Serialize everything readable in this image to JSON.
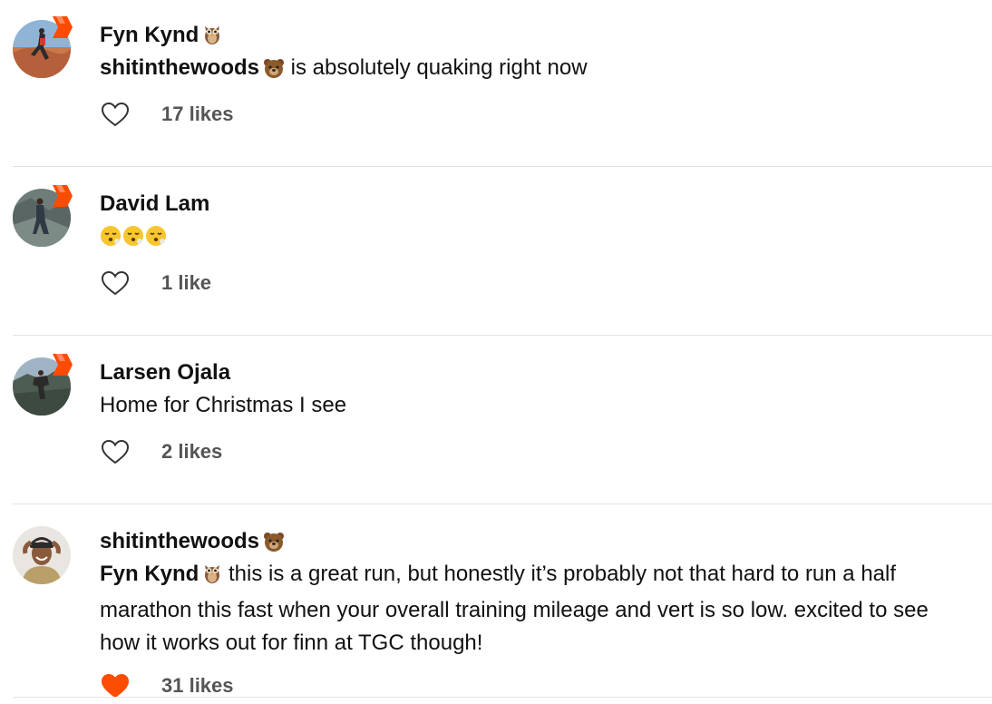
{
  "comments": [
    {
      "author": "Fyn Kynd",
      "author_emoji": "owl-emoji",
      "mention": "shitinthewoods",
      "mention_emoji": "bear-emoji",
      "text": " is absolutely quaking right now",
      "likes": "17 likes",
      "liked": false
    },
    {
      "author": "David Lam",
      "text": "",
      "text_emoji": [
        "face-exhaling-emoji",
        "face-exhaling-emoji",
        "face-exhaling-emoji"
      ],
      "likes": "1 like",
      "liked": false
    },
    {
      "author": "Larsen Ojala",
      "text": "Home for Christmas I see",
      "likes": "2 likes",
      "liked": false
    },
    {
      "author": "shitinthewoods",
      "author_emoji": "bear-emoji",
      "mention": "Fyn Kynd",
      "mention_emoji": "owl-emoji",
      "text_line1": " this is a great run, but honestly it’s probably not that hard to run a half",
      "text_line2": "marathon this fast when your overall training mileage and vert is so low. excited to see",
      "text_line3": "how it works out for finn at TGC though!",
      "likes": "31 likes",
      "liked": true
    }
  ],
  "colors": {
    "accent": "#fc4c02",
    "text": "#111111",
    "muted": "#555555",
    "divider": "#e2e2e2"
  }
}
